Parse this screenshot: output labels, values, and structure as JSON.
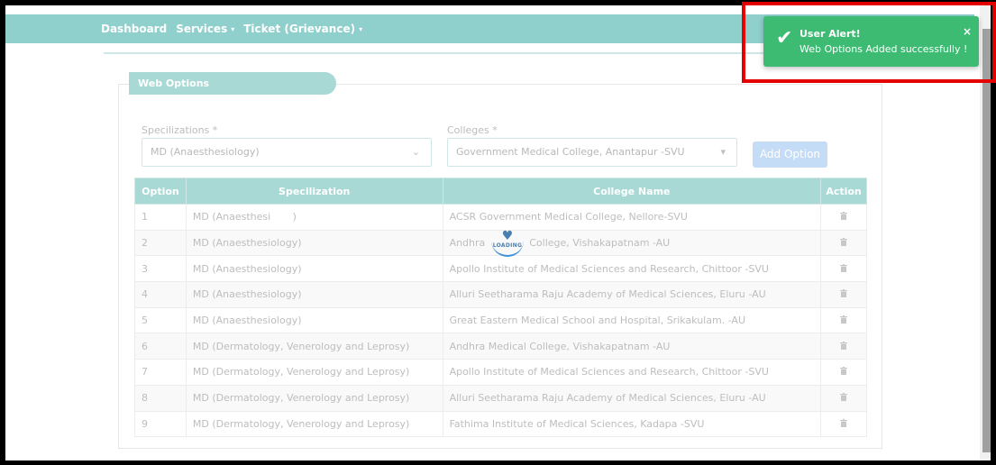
{
  "navbar": {
    "items": [
      {
        "label": "Dashboard"
      },
      {
        "label": "Services",
        "caret": "▾"
      },
      {
        "label": "Ticket (Grievance)",
        "caret": "▾"
      }
    ]
  },
  "panel": {
    "title": "Web Options",
    "specializations_label": "Specilizations *",
    "specializations_value": "MD (Anaesthesiology)",
    "colleges_label": "Colleges *",
    "colleges_value": "Government Medical College, Anantapur -SVU",
    "add_button": "Add Option"
  },
  "table": {
    "headers": [
      "Option",
      "Specilization",
      "College Name",
      "Action"
    ],
    "rows": [
      {
        "option": "1",
        "spec": "MD (Anaesthesi       )",
        "college": "ACSR Government Medical College, Nellore-SVU"
      },
      {
        "option": "2",
        "spec": "MD (Anaesthesiology)",
        "college": "Andhra              College, Vishakapatnam -AU"
      },
      {
        "option": "3",
        "spec": "MD (Anaesthesiology)",
        "college": "Apollo Institute of Medical Sciences and Research, Chittoor -SVU"
      },
      {
        "option": "4",
        "spec": "MD (Anaesthesiology)",
        "college": "Alluri Seetharama Raju Academy of Medical Sciences, Eluru -AU"
      },
      {
        "option": "5",
        "spec": "MD (Anaesthesiology)",
        "college": "Great Eastern Medical School and Hospital, Srikakulam. -AU"
      },
      {
        "option": "6",
        "spec": "MD (Dermatology, Venerology and Leprosy)",
        "college": "Andhra Medical College, Vishakapatnam -AU"
      },
      {
        "option": "7",
        "spec": "MD (Dermatology, Venerology and Leprosy)",
        "college": "Apollo Institute of Medical Sciences and Research, Chittoor -SVU"
      },
      {
        "option": "8",
        "spec": "MD (Dermatology, Venerology and Leprosy)",
        "college": "Alluri Seetharama Raju Academy of Medical Sciences, Eluru -AU"
      },
      {
        "option": "9",
        "spec": "MD (Dermatology, Venerology and Leprosy)",
        "college": "Fathima Institute of Medical Sciences, Kadapa -SVU"
      }
    ],
    "delete_icon": "trash-icon"
  },
  "loader": {
    "text": "LOADING"
  },
  "toast": {
    "title": "User Alert!",
    "message": "Web Options Added successfully !",
    "close": "×",
    "icon": "check-icon",
    "color": "#3dbb73"
  },
  "highlight_color": "#e50000"
}
